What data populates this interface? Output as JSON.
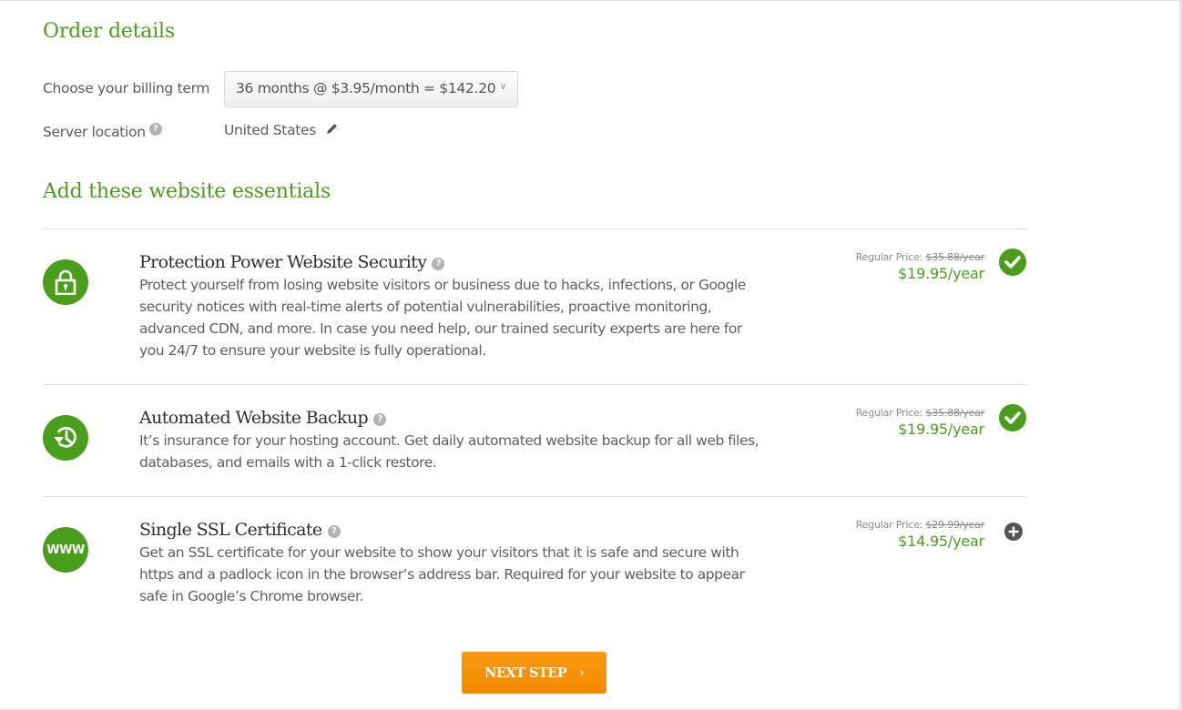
{
  "order_details": {
    "title": "Order details",
    "billing_term_label": "Choose your billing term",
    "billing_term_value": "36 months @ $3.95/month = $142.20",
    "server_location_label": "Server location",
    "server_location_value": "United States"
  },
  "essentials": {
    "title": "Add these website essentials",
    "items": [
      {
        "icon": "padlock-icon",
        "title": "Protection Power Website Security",
        "description": "Protect yourself from losing website visitors or business due to hacks, infections, or Google security notices with real-time alerts of potential vulnerabilities, proactive monitoring, advanced CDN, and more. In case you need help, our trained security experts are here for you 24/7 to ensure your website is fully operational.",
        "regular_label": "Regular Price:",
        "regular_price": "$35.88/year",
        "price": "$19.95/year",
        "selected": true
      },
      {
        "icon": "backup-clock-icon",
        "title": "Automated Website Backup",
        "description": "It’s insurance for your hosting account. Get daily automated website backup for all web files, databases, and emails with a 1-click restore.",
        "regular_label": "Regular Price:",
        "regular_price": "$35.88/year",
        "price": "$19.95/year",
        "selected": true
      },
      {
        "icon": "www-icon",
        "www_text": "WWW",
        "title": "Single SSL Certificate",
        "description": "Get an SSL certificate for your website to show your visitors that it is safe and secure with https and a padlock icon in the browser’s address bar. Required for your website to appear safe in Google’s Chrome browser.",
        "regular_label": "Regular Price:",
        "regular_price": "$29.99/year",
        "price": "$14.95/year",
        "selected": false
      }
    ]
  },
  "actions": {
    "next_step_label": "NEXT STEP"
  },
  "glyphs": {
    "help": "?",
    "chevron_down": "⌄",
    "pencil": "✎",
    "chevron_right": "›"
  },
  "colors": {
    "brand_green": "#4a9e1c",
    "cta_orange": "#f7920a",
    "add_icon_gray": "#555555"
  }
}
